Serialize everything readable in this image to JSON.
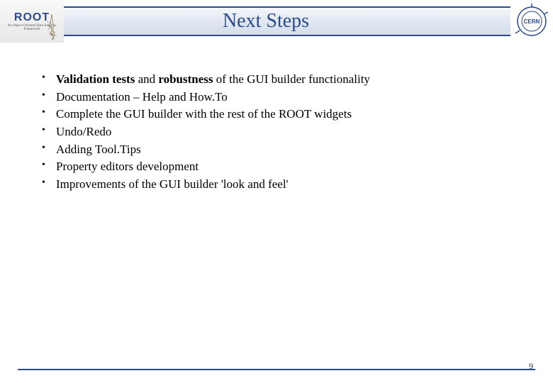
{
  "header": {
    "logo_text": "ROOT",
    "logo_subtitle": "An Object-Oriented Data Analysis Framework",
    "title": "Next Steps",
    "right_logo": "CERN"
  },
  "bullets": [
    {
      "strong": "Validation tests",
      "mid": " and ",
      "strong2": "robustness",
      "rest": " of the GUI builder functionality"
    },
    {
      "text": "Documentation – Help and How.To"
    },
    {
      "text": "Complete the GUI builder with the rest of the ROOT widgets"
    },
    {
      "text": "Undo/Redo"
    },
    {
      "text": "Adding Tool.Tips"
    },
    {
      "text": "Property editors development"
    },
    {
      "text": "Improvements of the GUI builder 'look and feel'"
    }
  ],
  "footer": {
    "page_number": "9"
  }
}
